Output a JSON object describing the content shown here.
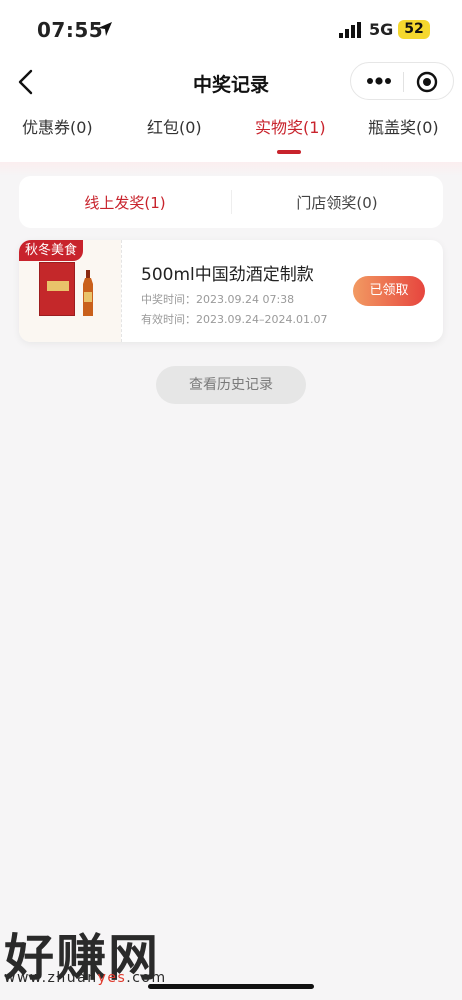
{
  "status_bar": {
    "time": "07:55",
    "network": "5G",
    "battery": "52"
  },
  "nav": {
    "title": "中奖记录",
    "back_icon": "chevron-left-icon",
    "more_icon": "more-dots-icon",
    "target_icon": "target-icon"
  },
  "tabs": [
    {
      "label": "优惠券(0)",
      "active": false
    },
    {
      "label": "红包(0)",
      "active": false
    },
    {
      "label": "实物奖(1)",
      "active": true
    },
    {
      "label": "瓶盖奖(0)",
      "active": false
    }
  ],
  "subtabs": [
    {
      "label": "线上发奖(1)",
      "active": true
    },
    {
      "label": "门店领奖(0)",
      "active": false
    }
  ],
  "prize": {
    "badge": "秋冬美食",
    "name": "500ml中国劲酒定制款",
    "win_time": "中奖时间：2023.09.24 07:38",
    "valid_time": "有效时间：2023.09.24–2024.01.07",
    "status": "已领取"
  },
  "history_button": "查看历史记录",
  "watermark": {
    "text": "好赚网",
    "url_pre": "www.zhuan",
    "url_hl": "yes",
    "url_post": ".com"
  },
  "colors": {
    "accent": "#c8232c",
    "button_gradient_start": "#f29a62",
    "button_gradient_end": "#e6453e",
    "background": "#f6f5f6"
  }
}
